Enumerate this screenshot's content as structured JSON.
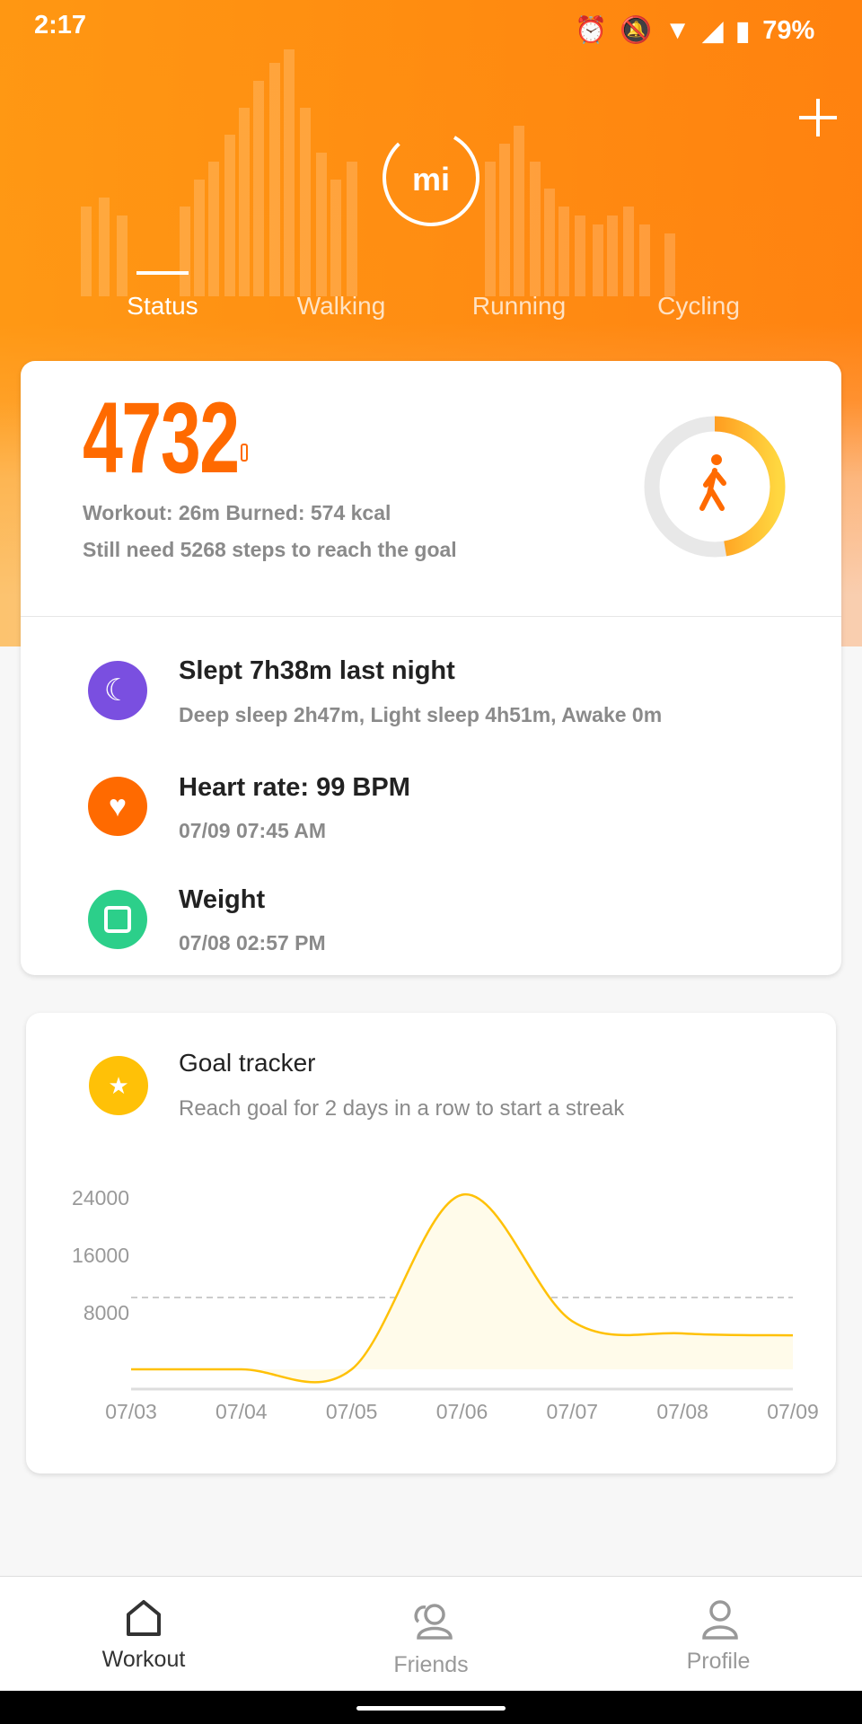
{
  "status_bar": {
    "time": "2:17",
    "battery": "79%"
  },
  "header": {
    "tabs": [
      {
        "label": "Status",
        "active": true
      },
      {
        "label": "Walking"
      },
      {
        "label": "Running"
      },
      {
        "label": "Cycling"
      }
    ],
    "accent": "#ff8a10"
  },
  "steps_card": {
    "steps": "4732",
    "workout_line": "Workout: 26m Burned: 574 kcal",
    "goal_line": "Still need 5268 steps to reach the goal",
    "progress_fraction": 0.4732
  },
  "health_rows": [
    {
      "icon": "moon-icon",
      "color": "#7a4fe0",
      "title": "Slept 7h38m last night",
      "sub": "Deep sleep 2h47m, Light sleep 4h51m, Awake 0m"
    },
    {
      "icon": "heart-icon",
      "color": "#ff6a00",
      "title": "Heart rate: 99 BPM",
      "sub": "07/09 07:45 AM"
    },
    {
      "icon": "scale-icon",
      "color": "#2ccf8a",
      "title": "Weight",
      "sub": "07/08 02:57 PM"
    }
  ],
  "goal_tracker": {
    "title": "Goal tracker",
    "subtitle": "Reach goal for 2 days in a row to start a streak"
  },
  "chart_data": {
    "type": "line",
    "categories": [
      "07/03",
      "07/04",
      "07/05",
      "07/06",
      "07/07",
      "07/08",
      "07/09"
    ],
    "values": [
      0,
      0,
      0,
      24300,
      6700,
      5000,
      4732
    ],
    "goal_line": 10000,
    "y_ticks": [
      "24000",
      "16000",
      "8000"
    ],
    "ylim": [
      0,
      24000
    ],
    "color": "#ffc107",
    "grid": false
  },
  "bottom_nav": [
    {
      "label": "Workout",
      "active": true
    },
    {
      "label": "Friends"
    },
    {
      "label": "Profile"
    }
  ]
}
